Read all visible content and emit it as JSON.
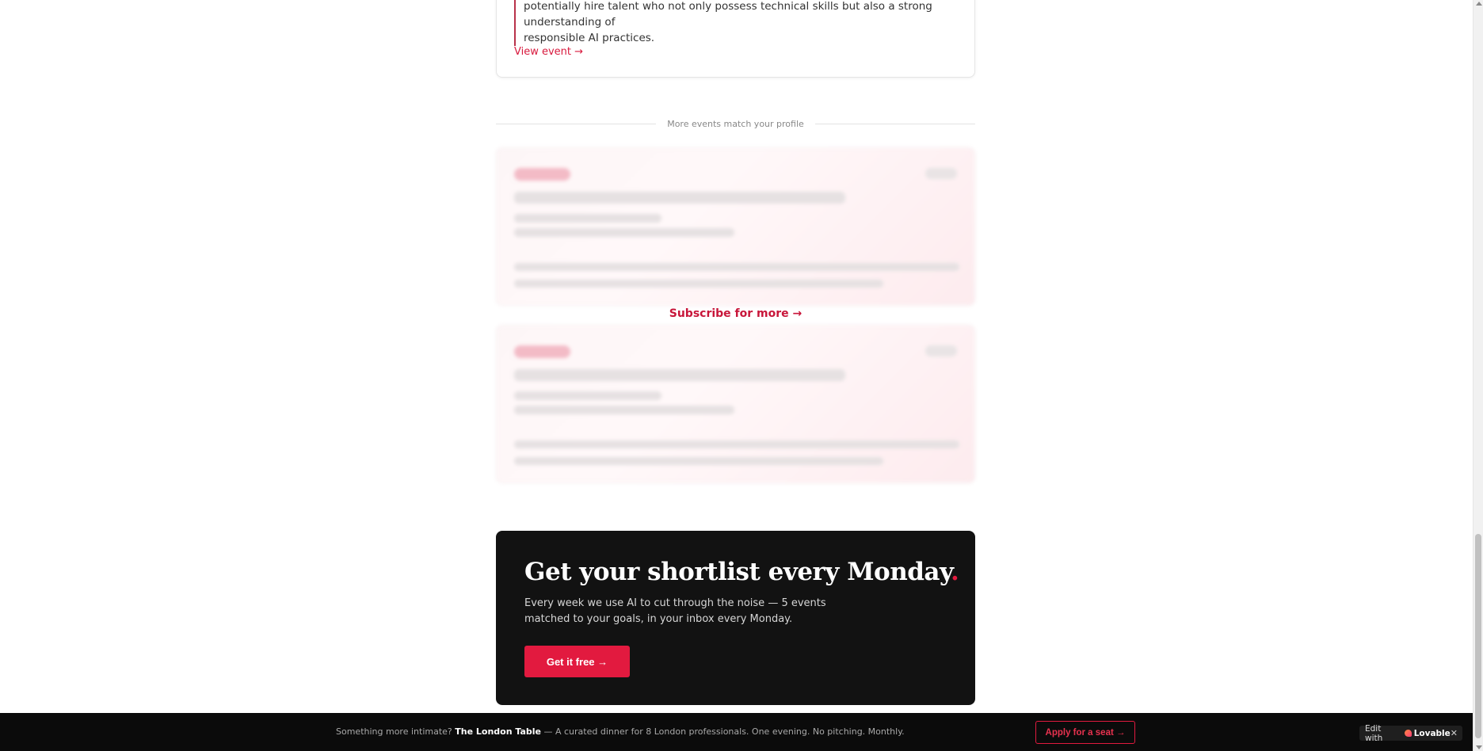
{
  "event_card": {
    "quote_lines": [
      "potentially hire talent who not only possess technical skills but also a strong understanding of",
      "responsible AI practices."
    ],
    "view_link": "View event →"
  },
  "divider": {
    "label": "More events match your profile"
  },
  "locked": {
    "subscribe_label": "Subscribe for more →"
  },
  "cta": {
    "title": "Get your shortlist every Monday",
    "title_dot": ".",
    "description": "Every week we use AI to cut through the noise — 5 events matched to your goals, in your inbox every Monday.",
    "button_label": "Get it free →"
  },
  "banner": {
    "lead": "Something more intimate?",
    "name": "The London Table",
    "tail": "— A curated dinner for 8 London professionals. One evening. No pitching. Monthly.",
    "apply_label": "Apply for a seat →"
  },
  "lovable": {
    "edit_label": "Edit with",
    "brand": "Lovable",
    "close": "✕"
  },
  "colors": {
    "accent": "#e21a3f",
    "cta_bg": "#121212",
    "banner_bg": "#0b0b0b"
  }
}
